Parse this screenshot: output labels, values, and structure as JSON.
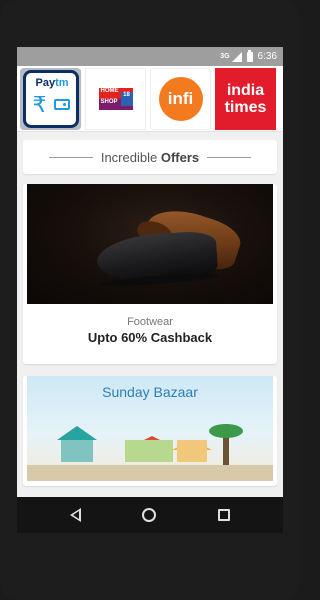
{
  "status_bar": {
    "network_tag": "3G",
    "time": "6:36",
    "icons": [
      "signal-icon",
      "battery-icon"
    ]
  },
  "partners": [
    {
      "name": "Paytm",
      "logo_text_1": "Pay",
      "logo_text_2": "tm",
      "icons": [
        "rupee-icon",
        "wallet-icon"
      ],
      "color": "#0b2e64"
    },
    {
      "name": "HomeShop18",
      "logo_text_1": "HOME",
      "logo_text_2": "SHOP",
      "logo_text_3": "18",
      "color": "#e2241f"
    },
    {
      "name": "infi",
      "logo_text": "infi",
      "color": "#f47a20"
    },
    {
      "name": "indiatimes",
      "logo_line_1": "india",
      "logo_line_2": "times",
      "color": "#e31c2b"
    }
  ],
  "offers_header": {
    "prefix": "Incredible",
    "title": "Offers"
  },
  "offer_cards": [
    {
      "category": "Footwear",
      "offer": "Upto 60% Cashback"
    },
    {
      "banner_title": "Sunday Bazaar"
    }
  ],
  "nav": {
    "icons": [
      "back-icon",
      "home-icon",
      "recents-icon"
    ]
  }
}
